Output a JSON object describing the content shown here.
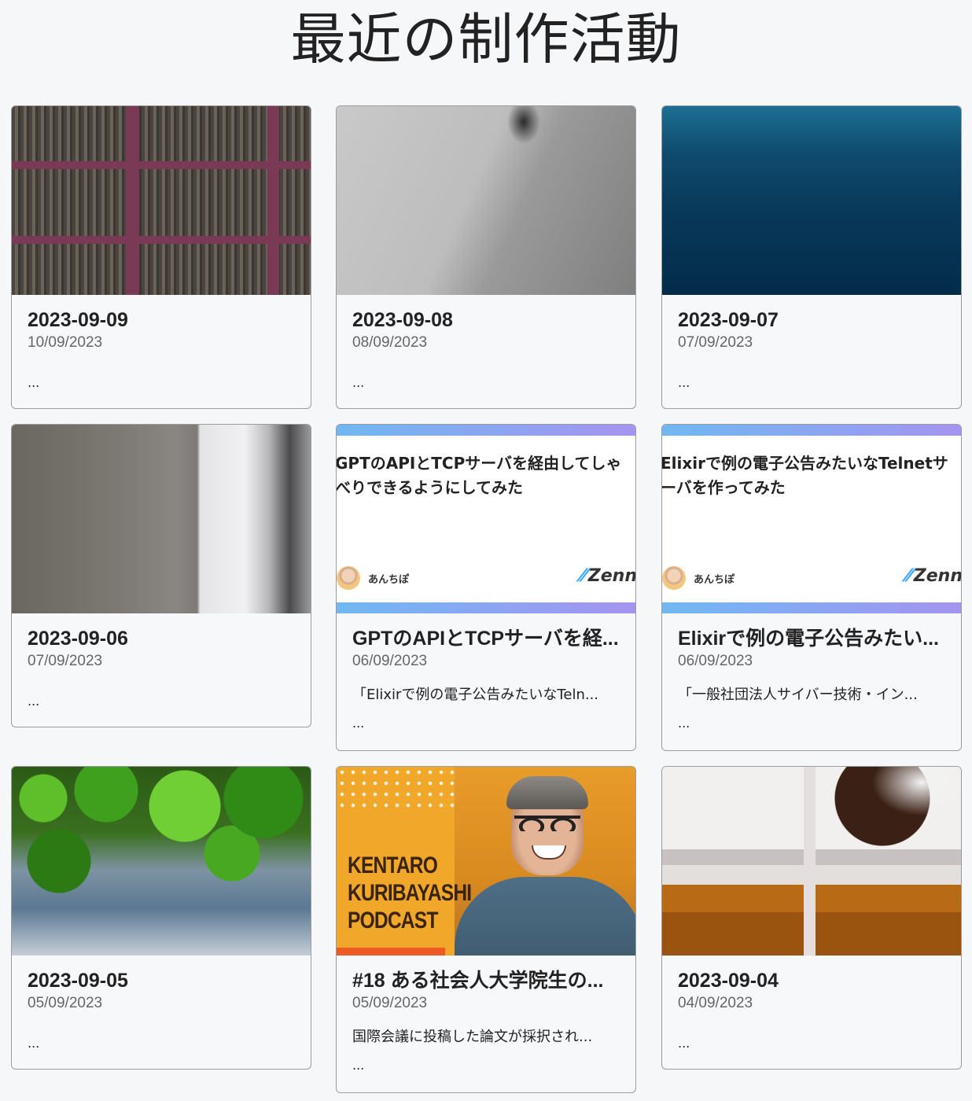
{
  "page": {
    "title": "最近の制作活動"
  },
  "cards": [
    {
      "title": "2023-09-09",
      "date": "10/09/2023",
      "desc": "",
      "ellipsis": "..."
    },
    {
      "title": "2023-09-08",
      "date": "08/09/2023",
      "desc": "",
      "ellipsis": "..."
    },
    {
      "title": "2023-09-07",
      "date": "07/09/2023",
      "desc": "",
      "ellipsis": "..."
    },
    {
      "title": "2023-09-06",
      "date": "07/09/2023",
      "desc": "",
      "ellipsis": "..."
    },
    {
      "title": "GPTのAPIとTCPサーバを経...",
      "date": "06/09/2023",
      "desc": "「Elixirで例の電子公告みたいなTeln...",
      "ellipsis": "...",
      "og": {
        "title": "GPTのAPIとTCPサーバを経由してしゃべりできるようにしてみた",
        "author": "あんちぽ",
        "logo": "Zenn"
      }
    },
    {
      "title": "Elixirで例の電子公告みたい...",
      "date": "06/09/2023",
      "desc": "「一般社団法人サイバー技術・イン...",
      "ellipsis": "...",
      "og": {
        "title": "Elixirで例の電子公告みたいなTelnetサーバを作ってみた",
        "author": "あんちぽ",
        "logo": "Zenn"
      }
    },
    {
      "title": "2023-09-05",
      "date": "05/09/2023",
      "desc": "",
      "ellipsis": "..."
    },
    {
      "title": "#18 ある社会人大学院生の...",
      "date": "05/09/2023",
      "desc": "国際会議に投稿した論文が採択され...",
      "ellipsis": "...",
      "art": {
        "lines": [
          "KENTARO",
          "KURIBAYASHI",
          "PODCAST"
        ]
      }
    },
    {
      "title": "2023-09-04",
      "date": "04/09/2023",
      "desc": "",
      "ellipsis": "..."
    }
  ],
  "colors": {
    "background": "#f6f7f9",
    "card_border": "#9a9ca0",
    "zenn_gradient_start": "#6fb8f2",
    "zenn_gradient_end": "#a594f0",
    "podcast_orange": "#f1a82a"
  },
  "icons": {
    "zenn_logo": "zenn-logo-icon",
    "author_avatar": "avatar"
  }
}
